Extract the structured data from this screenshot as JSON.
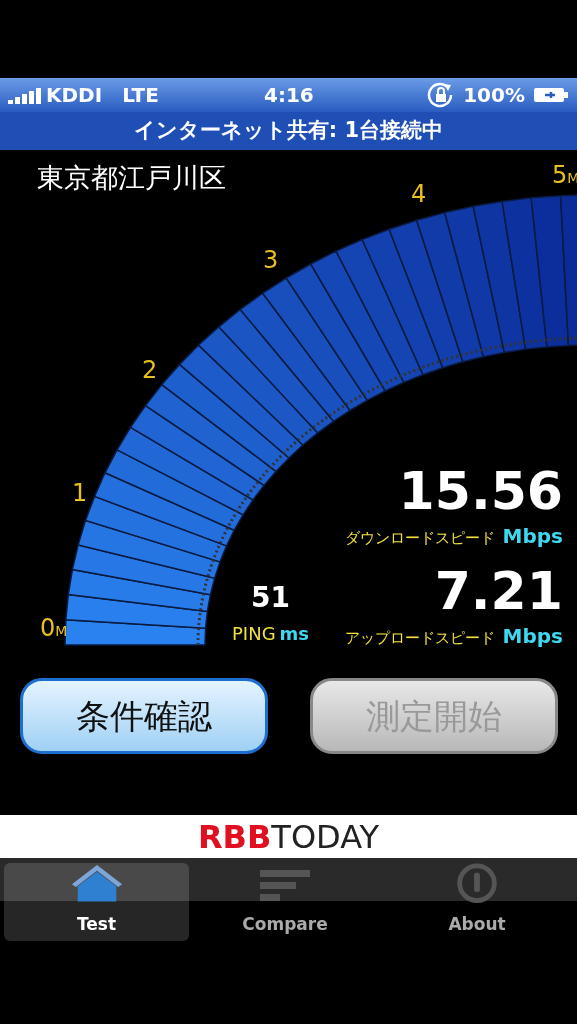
{
  "status_bar": {
    "carrier": "KDDI",
    "network": "LTE",
    "time": "4:16",
    "battery": "100%"
  },
  "tethering_bar": "インターネット共有: 1台接続中",
  "location": "東京都江戸川区",
  "gauge": {
    "ticks": [
      {
        "value": "0",
        "unit": "M"
      },
      {
        "value": "1"
      },
      {
        "value": "2"
      },
      {
        "value": "3"
      },
      {
        "value": "4"
      },
      {
        "value": "5",
        "unit": "M"
      }
    ]
  },
  "download": {
    "value": "15.56",
    "label": "ダウンロードスピード",
    "unit": "Mbps"
  },
  "upload": {
    "value": "7.21",
    "label": "アップロードスピード",
    "unit": "Mbps"
  },
  "ping": {
    "value": "51",
    "label": "PING",
    "unit": "ms"
  },
  "buttons": [
    {
      "label": "条件確認",
      "disabled": false
    },
    {
      "label": "測定開始",
      "disabled": true
    }
  ],
  "banner": {
    "logo_a": "RBB",
    "logo_b": "TODAY"
  },
  "tabs": [
    {
      "label": "Test",
      "kind": "home",
      "selected": true
    },
    {
      "label": "Compare",
      "kind": "bars",
      "selected": false
    },
    {
      "label": "About",
      "kind": "info",
      "selected": false
    }
  ]
}
